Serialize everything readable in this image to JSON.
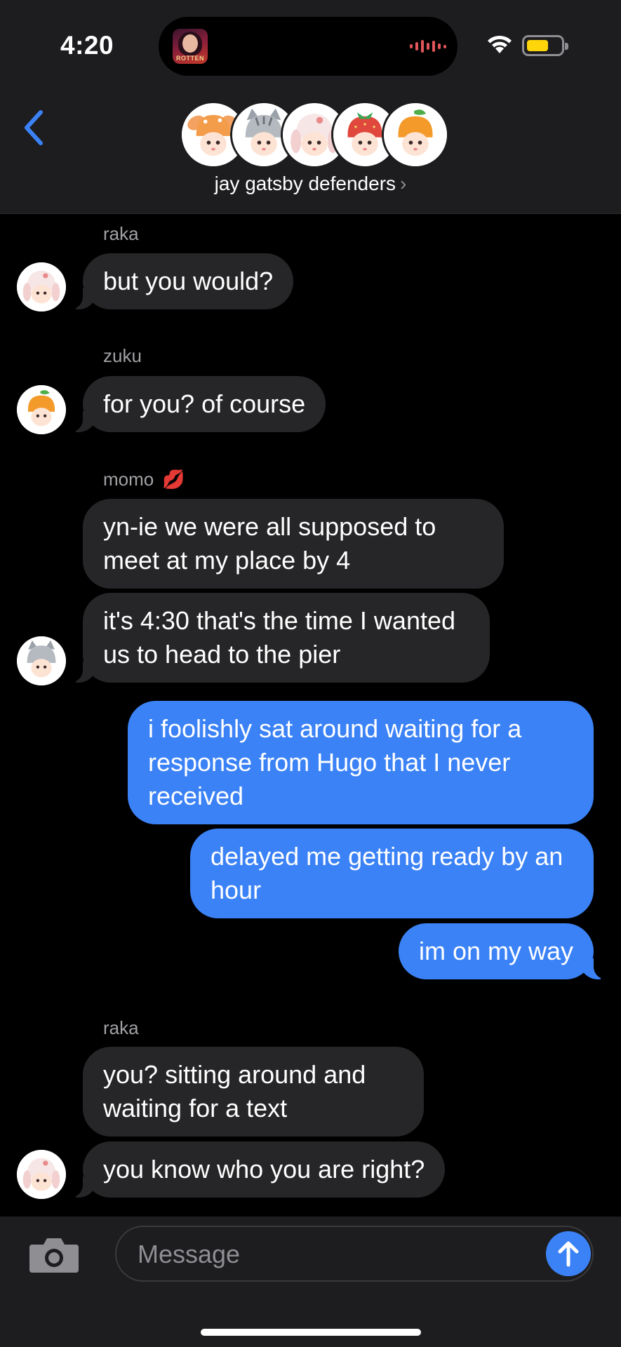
{
  "status_bar": {
    "time": "4:20",
    "now_playing_art_text": "ROTTEN",
    "wifi_icon": "wifi-icon",
    "battery_icon": "battery-icon",
    "battery_color": "#ffd60a"
  },
  "header": {
    "back_icon": "chevron-left-icon",
    "group_name": "jay gatsby defenders",
    "group_chevron": "›",
    "avatars": [
      "deer-doll-avatar",
      "cat-doll-avatar",
      "bunny-doll-avatar",
      "strawberry-doll-avatar",
      "orange-doll-avatar"
    ]
  },
  "messages": [
    {
      "sender": "raka",
      "text": "but you would?",
      "direction": "in"
    },
    {
      "sender": "zuku",
      "text": "for you? of course",
      "direction": "in"
    },
    {
      "sender": "momo",
      "sender_emoji": "💋",
      "text": "yn-ie we were all supposed to meet at my place by 4",
      "direction": "in"
    },
    {
      "text": "it's 4:30 that's the time I wanted us to head to the pier",
      "direction": "in"
    },
    {
      "text": "i foolishly sat around waiting for a response from Hugo that I never received",
      "direction": "out"
    },
    {
      "text": "delayed me getting ready by an hour",
      "direction": "out"
    },
    {
      "text": "im on my way",
      "direction": "out"
    },
    {
      "sender": "raka",
      "text": "you? sitting around and waiting for a text",
      "direction": "in"
    },
    {
      "text": "you know who you are right?",
      "direction": "in"
    }
  ],
  "compose": {
    "placeholder": "Message",
    "camera_icon": "camera-icon",
    "send_icon": "arrow-up-icon",
    "accent": "#3b82f6"
  }
}
